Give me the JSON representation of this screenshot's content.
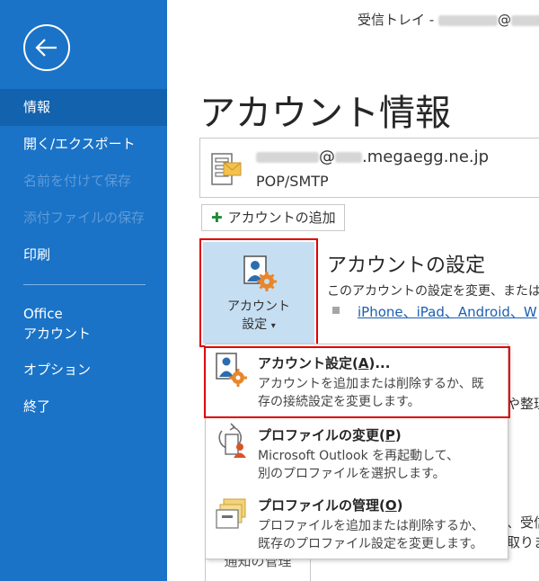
{
  "window": {
    "inbox_prefix": "受信トレイ - ",
    "at": "@"
  },
  "sidebar": {
    "back_label": "back",
    "items": [
      {
        "label": "情報",
        "state": "selected"
      },
      {
        "label": "開く/エクスポート",
        "state": "normal"
      },
      {
        "label": "名前を付けて保存",
        "state": "disabled"
      },
      {
        "label": "添付ファイルの保存",
        "state": "disabled"
      },
      {
        "label": "印刷",
        "state": "normal"
      }
    ],
    "office_account_line1": "Office",
    "office_account_line2": "アカウント",
    "options": "オプション",
    "exit": "終了",
    "color": "#1a73c7"
  },
  "main": {
    "title": "アカウント情報",
    "account": {
      "email_at": "@",
      "email_domain": ".megaegg.ne.jp",
      "type": "POP/SMTP"
    },
    "add_account_label": "アカウントの追加",
    "settings_button": {
      "line1": "アカウント",
      "line2": "設定",
      "arrow": "▾"
    },
    "settings_title": "アカウントの設定",
    "settings_desc": "このアカウントの設定を変更、または追",
    "settings_link": "iPhone、iPad、Android、W",
    "bg_text_1": "や整理",
    "bg_text_2": "、受信",
    "bg_text_3": "取りま",
    "bg_button_label": "通知の管理"
  },
  "dropdown": {
    "items": [
      {
        "title": "アカウント設定(",
        "accel": "A",
        "suffix": ")...",
        "desc1": "アカウントを追加または削除するか、既",
        "desc2": "存の接続設定を変更します。",
        "icon": "account-settings-icon"
      },
      {
        "title": "プロファイルの変更(",
        "accel": "P",
        "suffix": ")",
        "desc1": "Microsoft Outlook を再起動して、",
        "desc2": "別のプロファイルを選択します。",
        "icon": "change-profile-icon"
      },
      {
        "title": "プロファイルの管理(",
        "accel": "O",
        "suffix": ")",
        "desc1": "プロファイルを追加または削除するか、",
        "desc2": "既存のプロファイル設定を変更します。",
        "icon": "manage-profiles-icon"
      }
    ]
  },
  "colors": {
    "highlight_border": "#e00000",
    "link": "#1a5fb4",
    "button_bg": "#c6def2"
  }
}
